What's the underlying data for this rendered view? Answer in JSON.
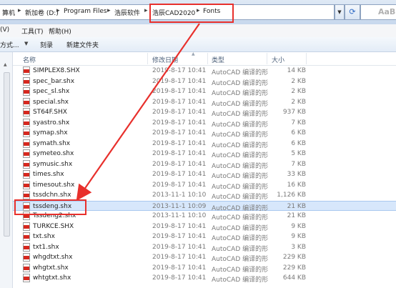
{
  "breadcrumb": {
    "items": [
      "算机",
      "新加卷 (D:)",
      "Program Files",
      "浩辰软件",
      "浩辰CAD2020",
      "Fonts"
    ],
    "search_text": "AaBl"
  },
  "menubar": {
    "items": [
      "(V)",
      "工具(T)",
      "帮助(H)"
    ]
  },
  "toolbar": {
    "items": [
      "方式...",
      "刻录",
      "新建文件夹"
    ]
  },
  "columns": {
    "name": "名称",
    "date": "修改日期",
    "type": "类型",
    "size": "大小"
  },
  "files": [
    {
      "name": "SIMPLEX8.SHX",
      "date": "2019-8-17 10:41",
      "type": "AutoCAD 编译的形",
      "size": "14 KB"
    },
    {
      "name": "spec_bar.shx",
      "date": "2019-8-17 10:41",
      "type": "AutoCAD 编译的形",
      "size": "2 KB"
    },
    {
      "name": "spec_sl.shx",
      "date": "2019-8-17 10:41",
      "type": "AutoCAD 编译的形",
      "size": "2 KB"
    },
    {
      "name": "special.shx",
      "date": "2019-8-17 10:41",
      "type": "AutoCAD 编译的形",
      "size": "2 KB"
    },
    {
      "name": "ST64F.SHX",
      "date": "2019-8-17 10:41",
      "type": "AutoCAD 编译的形",
      "size": "937 KB"
    },
    {
      "name": "syastro.shx",
      "date": "2019-8-17 10:41",
      "type": "AutoCAD 编译的形",
      "size": "7 KB"
    },
    {
      "name": "symap.shx",
      "date": "2019-8-17 10:41",
      "type": "AutoCAD 编译的形",
      "size": "6 KB"
    },
    {
      "name": "symath.shx",
      "date": "2019-8-17 10:41",
      "type": "AutoCAD 编译的形",
      "size": "6 KB"
    },
    {
      "name": "symeteo.shx",
      "date": "2019-8-17 10:41",
      "type": "AutoCAD 编译的形",
      "size": "5 KB"
    },
    {
      "name": "symusic.shx",
      "date": "2019-8-17 10:41",
      "type": "AutoCAD 编译的形",
      "size": "7 KB"
    },
    {
      "name": "times.shx",
      "date": "2019-8-17 10:41",
      "type": "AutoCAD 编译的形",
      "size": "33 KB"
    },
    {
      "name": "timesout.shx",
      "date": "2019-8-17 10:41",
      "type": "AutoCAD 编译的形",
      "size": "16 KB"
    },
    {
      "name": "tssdchn.shx",
      "date": "2013-11-1 10:10",
      "type": "AutoCAD 编译的形",
      "size": "1,126 KB"
    },
    {
      "name": "tssdeng.shx",
      "date": "2013-11-1 10:09",
      "type": "AutoCAD 编译的形",
      "size": "21 KB"
    },
    {
      "name": "Tssdeng2.shx",
      "date": "2013-11-1 10:10",
      "type": "AutoCAD 编译的形",
      "size": "21 KB"
    },
    {
      "name": "TURKCE.SHX",
      "date": "2019-8-17 10:41",
      "type": "AutoCAD 编译的形",
      "size": "9 KB"
    },
    {
      "name": "txt.shx",
      "date": "2019-8-17 10:41",
      "type": "AutoCAD 编译的形",
      "size": "9 KB"
    },
    {
      "name": "txt1.shx",
      "date": "2019-8-17 10:41",
      "type": "AutoCAD 编译的形",
      "size": "3 KB"
    },
    {
      "name": "whgdtxt.shx",
      "date": "2019-8-17 10:41",
      "type": "AutoCAD 编译的形",
      "size": "229 KB"
    },
    {
      "name": "whgtxt.shx",
      "date": "2019-8-17 10:41",
      "type": "AutoCAD 编译的形",
      "size": "229 KB"
    },
    {
      "name": "whtgtxt.shx",
      "date": "2019-8-17 10:41",
      "type": "AutoCAD 编译的形",
      "size": "644 KB"
    }
  ],
  "selected_index": 13,
  "colors": {
    "highlight_box": "#e8302c",
    "arrow": "#e8302c",
    "selection": "#d7e7fb"
  }
}
